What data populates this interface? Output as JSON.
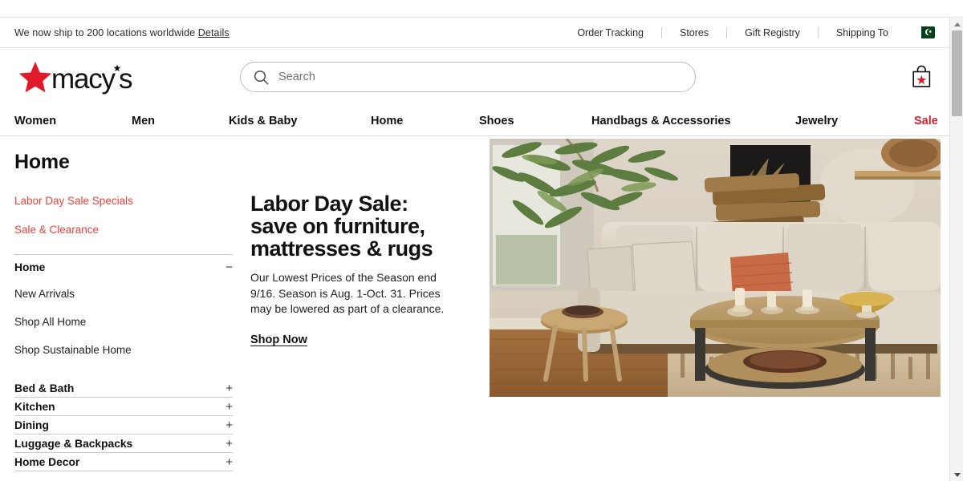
{
  "utility_bar": {
    "shipping_message": "We now ship to 200 locations worldwide",
    "details_link": "Details",
    "links": [
      "Order Tracking",
      "Stores",
      "Gift Registry",
      "Shipping To"
    ],
    "country_flag": "pakistan-flag-icon"
  },
  "masthead": {
    "logo_text": "macy's",
    "search": {
      "placeholder": "Search",
      "value": "",
      "icon": "search-icon"
    },
    "bag": {
      "icon": "shopping-bag-icon"
    }
  },
  "main_nav": {
    "items": [
      {
        "label": "Women",
        "sale": false
      },
      {
        "label": "Men",
        "sale": false
      },
      {
        "label": "Kids & Baby",
        "sale": false
      },
      {
        "label": "Home",
        "sale": false
      },
      {
        "label": "Shoes",
        "sale": false
      },
      {
        "label": "Handbags & Accessories",
        "sale": false
      },
      {
        "label": "Jewelry",
        "sale": false
      },
      {
        "label": "Sale",
        "sale": true
      }
    ]
  },
  "sidebar": {
    "title": "Home",
    "promo_links": [
      "Labor Day Sale Specials",
      "Sale & Clearance"
    ],
    "expanded_group": {
      "label": "Home",
      "toggle_sign": "−",
      "children": [
        "New Arrivals",
        "Shop All Home",
        "Shop Sustainable Home"
      ]
    },
    "collapsed_groups": [
      {
        "label": "Bed & Bath",
        "toggle_sign": "+"
      },
      {
        "label": "Kitchen",
        "toggle_sign": "+"
      },
      {
        "label": "Dining",
        "toggle_sign": "+"
      },
      {
        "label": "Luggage & Backpacks",
        "toggle_sign": "+"
      },
      {
        "label": "Home Decor",
        "toggle_sign": "+"
      }
    ]
  },
  "promo": {
    "headline_line1": "Labor Day Sale:",
    "headline_line2": "save on furniture,",
    "headline_line3": "mattresses & rugs",
    "body": "Our Lowest Prices of the Season end 9/16. Season is Aug. 1-Oct. 31. Prices may be lowered as part of a clearance.",
    "cta": "Shop Now"
  },
  "hero": {
    "alt": "living-room-sectional-sofa-coffee-table"
  },
  "colors": {
    "brand_red": "#e01a2b",
    "promo_red": "#e8413c",
    "text": "#111111",
    "flag_green": "#01411c"
  }
}
